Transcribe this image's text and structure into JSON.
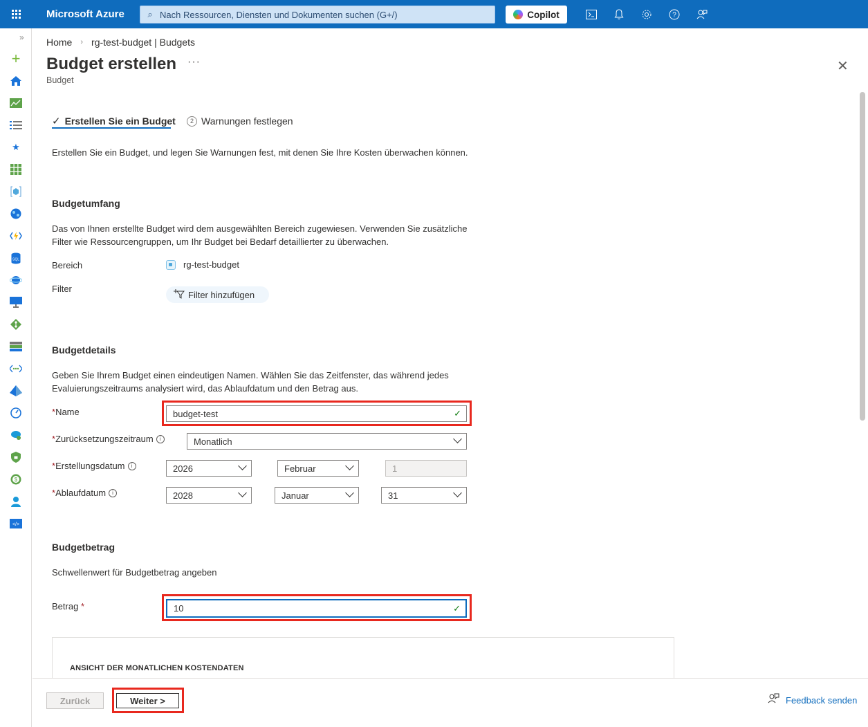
{
  "topbar": {
    "brand": "Microsoft Azure",
    "search_placeholder": "Nach Ressourcen, Diensten und Dokumenten suchen (G+/)",
    "copilot_label": "Copilot",
    "icons": [
      "terminal-icon",
      "bell-icon",
      "gear-icon",
      "help-icon",
      "feedback-icon"
    ]
  },
  "rail": {
    "icons": [
      "plus-icon",
      "home-icon",
      "dashboard-icon",
      "list-icon",
      "star-icon",
      "all-services-icon",
      "resource-group-icon",
      "globe-icon",
      "function-icon",
      "sql-icon",
      "network-icon",
      "monitor-icon",
      "git-icon",
      "storage-icon",
      "endpoints-icon",
      "azure-ad-icon",
      "speed-icon",
      "cloud-icon",
      "security-icon",
      "cost-icon",
      "user-icon",
      "devops-icon"
    ]
  },
  "breadcrumb": {
    "home": "Home",
    "parent": "rg-test-budget | Budgets"
  },
  "header": {
    "title": "Budget erstellen",
    "more": "···",
    "subtitle": "Budget"
  },
  "tabs": [
    {
      "label": "Erstellen Sie ein Budget",
      "state": "active"
    },
    {
      "number": "2",
      "label": "Warnungen festlegen"
    }
  ],
  "intro": "Erstellen Sie ein Budget, und legen Sie Warnungen fest, mit denen Sie Ihre Kosten überwachen können.",
  "scope": {
    "heading": "Budgetumfang",
    "desc_line1": "Das von Ihnen erstellte Budget wird dem ausgewählten Bereich zugewiesen. Verwenden Sie zusätzliche",
    "desc_line2": "Filter wie Ressourcengruppen, um Ihr Budget bei Bedarf detaillierter zu überwachen.",
    "bereich_label": "Bereich",
    "bereich_value": "rg-test-budget",
    "filter_label": "Filter",
    "filter_button": "Filter hinzufügen"
  },
  "details": {
    "heading": "Budgetdetails",
    "desc_line1": "Geben Sie Ihrem Budget einen eindeutigen Namen. Wählen Sie das Zeitfenster, das während jedes",
    "desc_line2": "Evaluierungszeitraums analysiert wird, das Ablaufdatum und den Betrag aus.",
    "name_label": "Name",
    "name_value": "budget-test",
    "reset_label": "Zurücksetzungszeitraum",
    "reset_value": "Monatlich",
    "start_label": "Erstellungsdatum",
    "start_year": "2026",
    "start_month": "Februar",
    "start_day": "1",
    "end_label": "Ablaufdatum",
    "end_year": "2028",
    "end_month": "Januar",
    "end_day": "31"
  },
  "amount": {
    "heading": "Budgetbetrag",
    "desc": "Schwellenwert für Budgetbetrag angeben",
    "label": "Betrag",
    "value": "10"
  },
  "cost_card": {
    "title": "ANSICHT DER MONATLICHEN KOSTENDATEN"
  },
  "footer": {
    "back": "Zurück",
    "next": "Weiter >",
    "feedback": "Feedback senden"
  },
  "colors": {
    "accent": "#0f6cbd",
    "highlight": "#e8281e",
    "required": "#a4262c",
    "valid": "#107c10"
  }
}
